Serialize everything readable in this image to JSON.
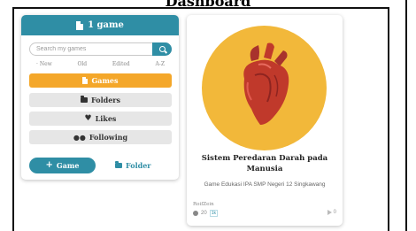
{
  "page": {
    "heading": "Dashboard"
  },
  "panel": {
    "title": "1 game",
    "search_placeholder": "Search my games",
    "sort_options": [
      "New",
      "Old",
      "Edited",
      "A-Z"
    ],
    "menu": [
      {
        "label": "Games",
        "icon": "document-icon",
        "active": true
      },
      {
        "label": "Folders",
        "icon": "folder-icon",
        "active": false
      },
      {
        "label": "Likes",
        "icon": "heart-icon",
        "active": false
      },
      {
        "label": "Following",
        "icon": "users-icon",
        "active": false
      }
    ],
    "add_game_label": "Game",
    "add_folder_label": "Folder"
  },
  "card": {
    "title": "Sistem Peredaran Darah pada Manusia",
    "subtitle": "Game Edukasi IPA SMP Negeri 12 Singkawang",
    "author": "RoifZein",
    "views": "20",
    "badge": "1k",
    "plays": "0"
  },
  "colors": {
    "accent": "#2f8ea5",
    "active": "#f4a72a",
    "thumb_bg": "#f2b83a",
    "heart": "#c0392b"
  }
}
